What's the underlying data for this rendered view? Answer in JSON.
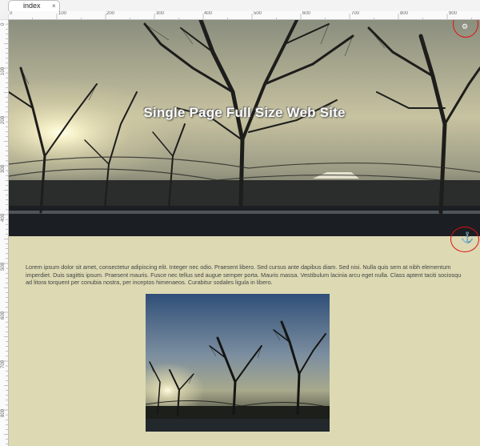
{
  "tab": {
    "label": "index",
    "close_glyph": "×"
  },
  "ruler": {
    "horizontal_labels": [
      "0",
      "100",
      "200",
      "300",
      "400",
      "500",
      "600",
      "700",
      "800",
      "900"
    ],
    "vertical_labels": [
      "0",
      "100",
      "200",
      "300",
      "400",
      "500",
      "600",
      "700",
      "800"
    ]
  },
  "hero": {
    "title": "Single Page Full Size Web Site",
    "corner_icon": "settings-icon",
    "sky_color": "#c7c2a0",
    "ground_color": "#1a1d22"
  },
  "anchor": {
    "icon": "anchor-icon",
    "glyph": "⚓"
  },
  "content": {
    "paragraph": "Lorem ipsum dolor sit amet, consectetur adipiscing elit. Integer nec odio. Praesent libero. Sed cursus ante dapibus diam. Sed nisi. Nulla quis sem at nibh elementum imperdiet. Duis sagittis ipsum. Praesent mauris. Fusce nec tellus sed augue semper porta. Mauris massa. Vestibulum lacinia arcu eget nulla. Class aptent taciti sociosqu ad litora torquent per conubia nostra, per inceptos himenaeos. Curabitur sodales ligula in libero.",
    "background": "#dcd9b3"
  },
  "colors": {
    "highlight_circle": "#e01010"
  }
}
